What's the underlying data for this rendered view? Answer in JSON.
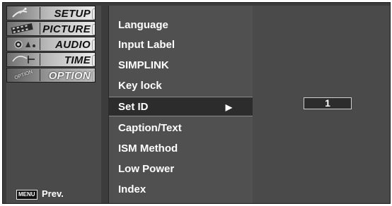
{
  "categories": [
    {
      "label": "SETUP",
      "icon": "satellite-dish-icon"
    },
    {
      "label": "PICTURE",
      "icon": "film-strip-icon"
    },
    {
      "label": "AUDIO",
      "icon": "speaker-icon"
    },
    {
      "label": "TIME",
      "icon": "clock-icon"
    },
    {
      "label": "OPTION",
      "icon": "option-tag-icon",
      "thumb_text": "OPTION"
    }
  ],
  "active_category": "OPTION",
  "footer": {
    "menu_key": "MENU",
    "prev_label": "Prev."
  },
  "submenu": {
    "items": [
      {
        "label": "Language"
      },
      {
        "label": "Input Label"
      },
      {
        "label": "SIMPLINK"
      },
      {
        "label": "Key lock"
      },
      {
        "label": "Set ID",
        "selected": true,
        "arrow": "▶"
      },
      {
        "label": "Caption/Text"
      },
      {
        "label": "ISM Method"
      },
      {
        "label": "Low Power"
      },
      {
        "label": "Index"
      }
    ]
  },
  "set_id_value": "1",
  "colors": {
    "panel_bg": "#505050",
    "selected_bg": "#2c2c2c",
    "text": "#ffffff"
  }
}
